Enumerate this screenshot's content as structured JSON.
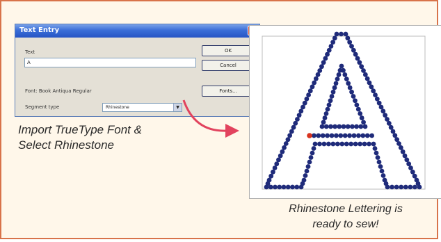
{
  "dialog": {
    "title": "Text Entry",
    "close_glyph": "×",
    "text_label": "Text",
    "text_value": "A",
    "ok_label": "OK",
    "cancel_label": "Cancel",
    "font_label": "Font: Book Antiqua Regular",
    "fonts_label": "Fonts...",
    "segment_label": "Segment type",
    "segment_value": "Rhinestone",
    "dropdown_glyph": "▼"
  },
  "captions": {
    "left_line1": "Import TrueType Font &",
    "left_line2": "Select Rhinestone",
    "right_line1": "Rhinestone Lettering is",
    "right_line2": "ready to sew!"
  },
  "colors": {
    "border_accent": "#d8734a",
    "arrow": "#e2435e",
    "stone": "#1f2b7a",
    "stone_highlight": "#d8331f",
    "background": "#fff7ea"
  },
  "icons": {
    "close": "close-icon",
    "dropdown": "chevron-down-icon",
    "arrow": "curved-arrow-icon"
  }
}
